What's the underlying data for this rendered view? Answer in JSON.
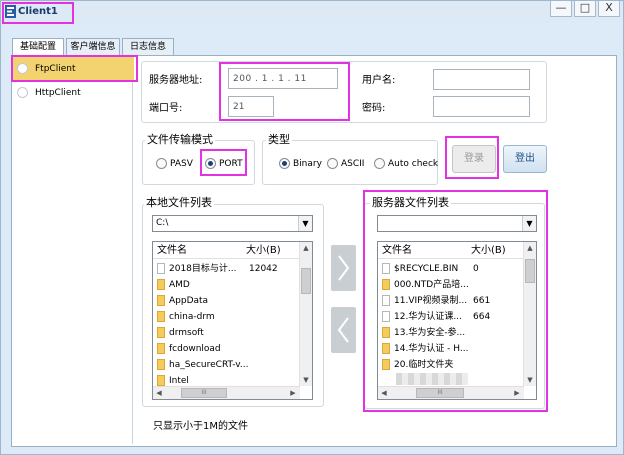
{
  "window": {
    "title": "Client1",
    "buttons": {
      "minimize": "—",
      "maximize": "□",
      "close": "X"
    }
  },
  "tabs": [
    {
      "label": "基础配置",
      "active": true
    },
    {
      "label": "客户端信息",
      "active": false
    },
    {
      "label": "日志信息",
      "active": false
    }
  ],
  "clients": [
    {
      "label": "FtpClient",
      "selected": true
    },
    {
      "label": "HttpClient",
      "selected": false
    }
  ],
  "server": {
    "address_label": "服务器地址:",
    "address_value": "200 . 1 . 1 . 11",
    "port_label": "端口号:",
    "port_value": "21",
    "username_label": "用户名:",
    "username_value": "",
    "password_label": "密码:",
    "password_value": ""
  },
  "transfer_mode": {
    "legend": "文件传输模式",
    "options": [
      {
        "label": "PASV",
        "checked": false
      },
      {
        "label": "PORT",
        "checked": true
      }
    ]
  },
  "type": {
    "legend": "类型",
    "options": [
      {
        "label": "Binary",
        "checked": true
      },
      {
        "label": "ASCII",
        "checked": false
      },
      {
        "label": "Auto check",
        "checked": false
      }
    ]
  },
  "actions": {
    "login": "登录",
    "logout": "登出"
  },
  "local": {
    "legend": "本地文件列表",
    "path": "C:\\",
    "columns": {
      "name": "文件名",
      "size": "大小(B)"
    },
    "files": [
      {
        "name": "2018目标与计...",
        "size": "12042",
        "type": "file"
      },
      {
        "name": "AMD",
        "size": "",
        "type": "folder"
      },
      {
        "name": "AppData",
        "size": "",
        "type": "folder"
      },
      {
        "name": "china-drm",
        "size": "",
        "type": "folder"
      },
      {
        "name": "drmsoft",
        "size": "",
        "type": "folder"
      },
      {
        "name": "fcdownload",
        "size": "",
        "type": "folder"
      },
      {
        "name": "ha_SecureCRT-v...",
        "size": "",
        "type": "folder"
      },
      {
        "name": "Intel",
        "size": "",
        "type": "folder"
      }
    ],
    "note": "只显示小于1M的文件"
  },
  "remote": {
    "legend": "服务器文件列表",
    "path": "",
    "columns": {
      "name": "文件名",
      "size": "大小(B)"
    },
    "files": [
      {
        "name": "$RECYCLE.BIN",
        "size": "0",
        "type": "file"
      },
      {
        "name": "000.NTD产品培...",
        "size": "",
        "type": "folder"
      },
      {
        "name": "11.VIP视频录制...",
        "size": "661",
        "type": "file"
      },
      {
        "name": "12.华为认证课...",
        "size": "664",
        "type": "file"
      },
      {
        "name": "13.华为安全-参...",
        "size": "",
        "type": "folder"
      },
      {
        "name": "14.华为认证 - H...",
        "size": "",
        "type": "folder"
      },
      {
        "name": "20.临时文件夹",
        "size": "",
        "type": "folder"
      }
    ]
  },
  "icons": {
    "app": "client-app-icon",
    "upload": "chevron-right-icon",
    "download": "chevron-left-icon",
    "dropdown": "chevron-down-icon"
  },
  "colors": {
    "highlight": "#e233e2",
    "selected": "#f3d36f",
    "window": "#dcebf7"
  }
}
